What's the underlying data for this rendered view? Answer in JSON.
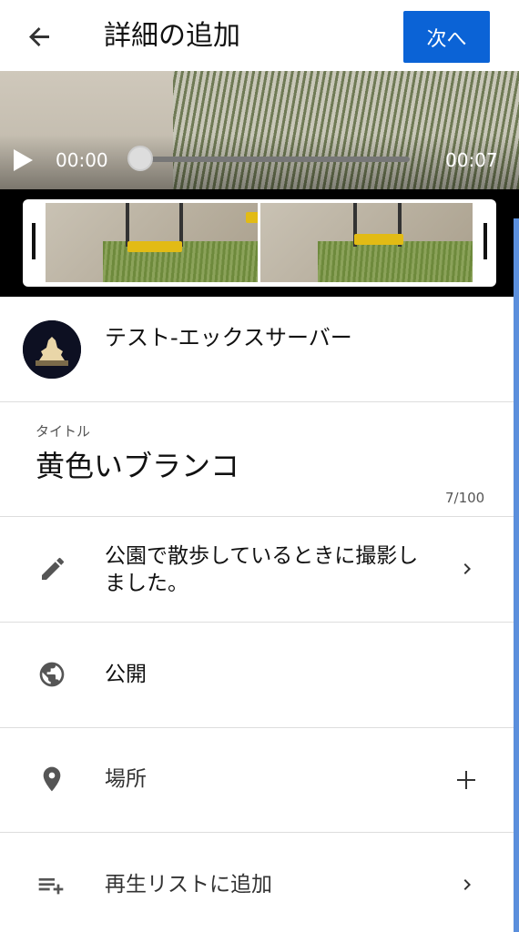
{
  "appbar": {
    "title": "詳細の追加",
    "next_label": "次へ",
    "back_icon": "arrow-back-icon"
  },
  "player": {
    "current_time": "00:00",
    "duration": "00:07",
    "progress": 0.0
  },
  "channel": {
    "name": "テスト-エックスサーバー"
  },
  "video": {
    "title_label": "タイトル",
    "title": "黄色いブランコ",
    "char_count": "7/100"
  },
  "details": {
    "description": "公園で散歩しているときに撮影しました。",
    "visibility": "公開",
    "location_placeholder": "場所",
    "playlist_label": "再生リストに追加"
  },
  "colors": {
    "primary": "#0b63d6",
    "accent_bar": "#5b8fdc",
    "swing_seat": "#e2bb15"
  },
  "icons": [
    "arrow-back-icon",
    "play-icon",
    "pencil-icon",
    "globe-icon",
    "location-pin-icon",
    "playlist-add-icon",
    "chevron-right-icon",
    "plus-icon"
  ]
}
